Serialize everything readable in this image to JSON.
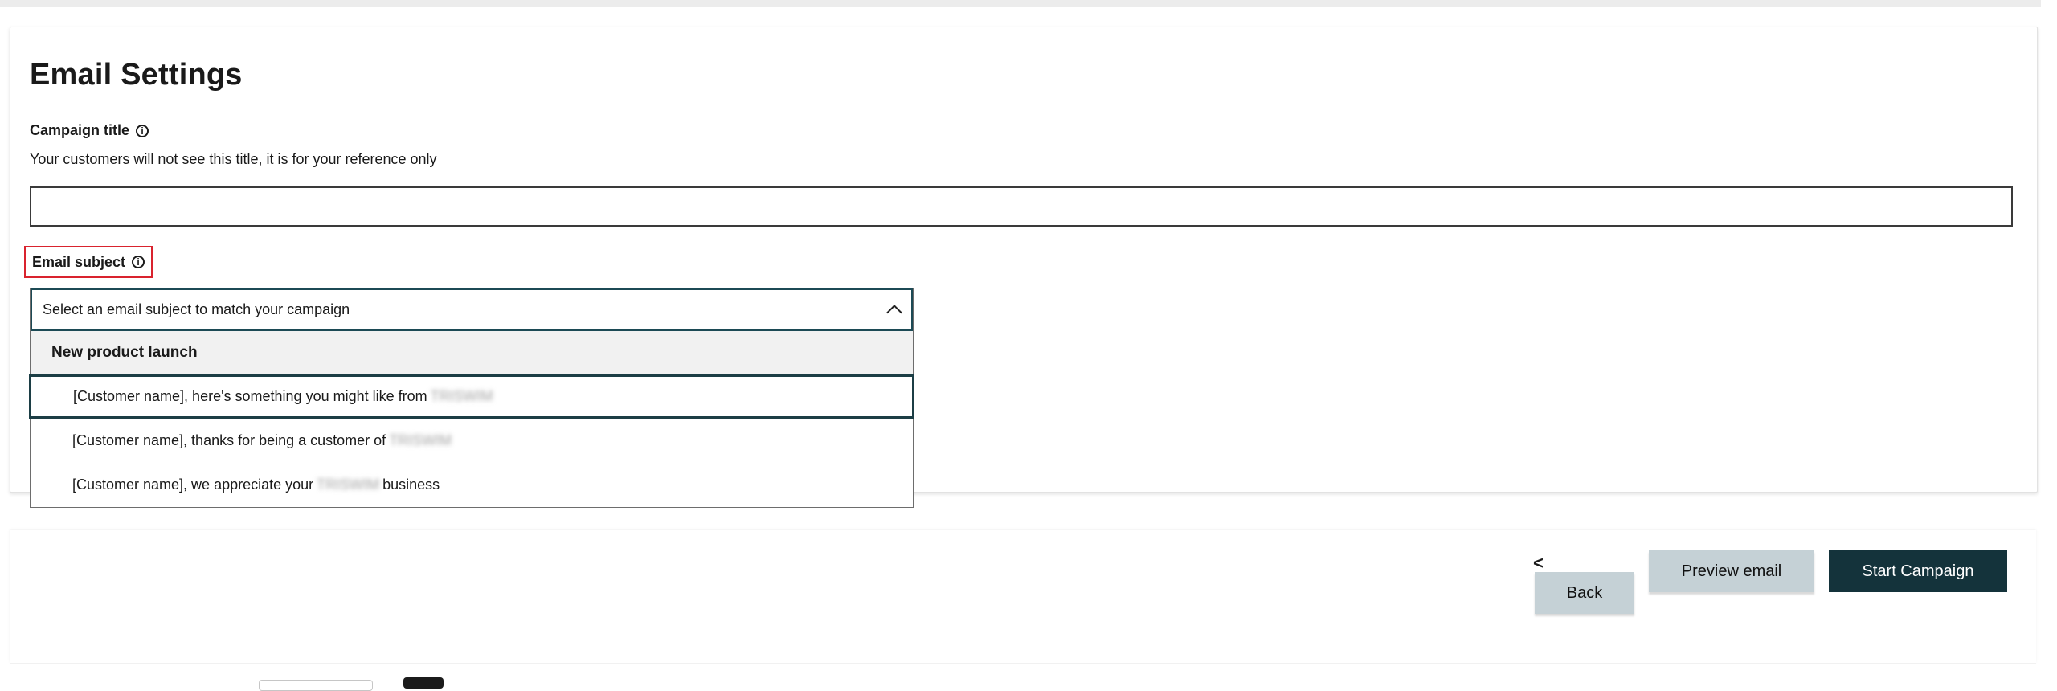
{
  "page": {
    "title": "Email Settings"
  },
  "campaign_title": {
    "label": "Campaign title",
    "help_text": "Your customers will not see this title, it is for your reference only",
    "value": "",
    "placeholder": ""
  },
  "email_subject": {
    "label": "Email subject",
    "placeholder": "Select an email subject to match your campaign",
    "group_label": "New product launch",
    "options": [
      {
        "prefix": "[Customer name], here's something you might like from",
        "brand": "TRISWIM",
        "suffix": ""
      },
      {
        "prefix": "[Customer name], thanks for being a customer of",
        "brand": "TRISWIM",
        "suffix": ""
      },
      {
        "prefix": "[Customer name], we appreciate your",
        "brand": "TRISWIM",
        "suffix": "business"
      }
    ]
  },
  "icons": {
    "info": "info-icon",
    "chevron": "chevron-up-icon",
    "back": "chevron-left-icon"
  },
  "footer": {
    "back_caret": "<",
    "back_label": "Back",
    "preview_label": "Preview email",
    "start_label": "Start Campaign"
  },
  "colors": {
    "primary_button": "#14333b",
    "secondary_button": "#c5d1d6",
    "highlight_border": "#d9232e",
    "focus_border": "#1c4a55"
  }
}
